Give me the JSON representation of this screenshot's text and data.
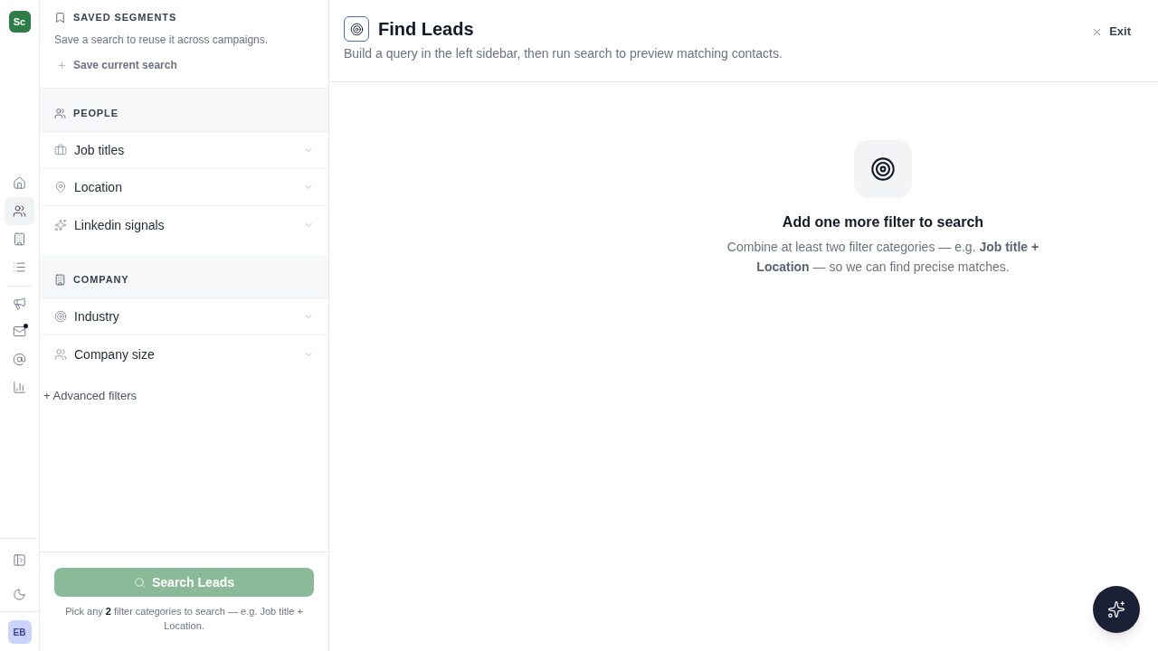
{
  "rail": {
    "logo": "Sc",
    "nav_groups": [
      {
        "items": [
          {
            "selected": false,
            "unread": false
          },
          {
            "selected": true,
            "unread": false
          },
          {
            "selected": false,
            "unread": false
          },
          {
            "selected": false,
            "unread": false
          }
        ]
      },
      {
        "items": [
          {
            "selected": false,
            "unread": false
          },
          {
            "selected": false,
            "unread": true
          },
          {
            "selected": false,
            "unread": false
          },
          {
            "selected": false,
            "unread": false
          }
        ]
      }
    ],
    "avatar": "EB"
  },
  "sidebar": {
    "saved_segments": {
      "title": "SAVED SEGMENTS",
      "description": "Save a search to reuse it across campaigns.",
      "action": "Save current search"
    },
    "filter_groups": [
      {
        "title": "PEOPLE",
        "filters": [
          {
            "label": "Job titles",
            "expanded": false
          },
          {
            "label": "Location",
            "expanded": false
          },
          {
            "label": "Linkedin signals",
            "expanded": false
          }
        ]
      },
      {
        "title": "COMPANY",
        "filters": [
          {
            "label": "Industry",
            "expanded": false
          },
          {
            "label": "Company size",
            "expanded": false
          }
        ]
      }
    ],
    "advanced_filters": "+ Advanced filters",
    "search_button": {
      "label": "Search Leads",
      "disabled": true
    },
    "hint": "Pick any **2** filter categories to search — e.g. Job title + Location."
  },
  "main": {
    "header": {
      "title": "Find Leads",
      "subtitle": "Build a query in the left sidebar, then run search to preview matching contacts.",
      "exit": "Exit"
    },
    "empty_state": {
      "title": "Add one more filter to search",
      "description": "Combine at least two filter categories — e.g. **Job title + Location** — so we can find precise matches."
    }
  }
}
